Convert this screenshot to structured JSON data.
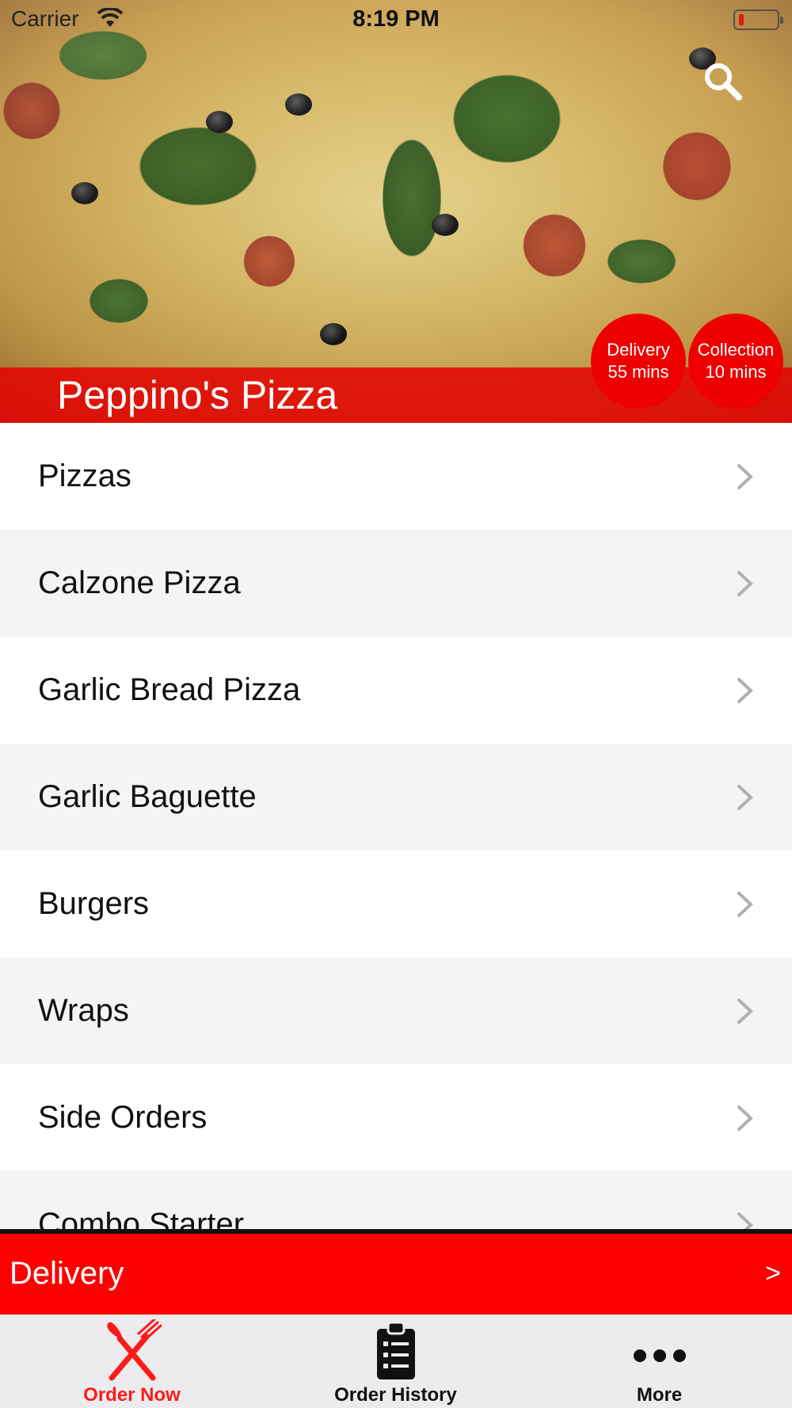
{
  "status_bar": {
    "carrier": "Carrier",
    "time": "8:19 PM"
  },
  "header": {
    "restaurant_name": "Peppino's Pizza",
    "search_icon": "search-icon",
    "delivery_badge": {
      "title": "Delivery",
      "time": "55 mins"
    },
    "collection_badge": {
      "title": "Collection",
      "time": "10 mins"
    }
  },
  "menu": {
    "categories": [
      {
        "label": "Pizzas"
      },
      {
        "label": "Calzone Pizza"
      },
      {
        "label": "Garlic Bread Pizza"
      },
      {
        "label": "Garlic Baguette"
      },
      {
        "label": "Burgers"
      },
      {
        "label": "Wraps"
      },
      {
        "label": "Side Orders"
      },
      {
        "label": "Combo Starter"
      }
    ]
  },
  "order_type_bar": {
    "label": "Delivery",
    "arrow": ">"
  },
  "tab_bar": {
    "tabs": [
      {
        "label": "Order Now",
        "icon": "fork-knife-icon",
        "active": true
      },
      {
        "label": "Order History",
        "icon": "clipboard-list-icon",
        "active": false
      },
      {
        "label": "More",
        "icon": "more-dots-icon",
        "active": false
      }
    ]
  },
  "colors": {
    "brand_red": "#ff0000",
    "active_tab": "#ff1a1a",
    "inactive_tab": "#111111"
  }
}
